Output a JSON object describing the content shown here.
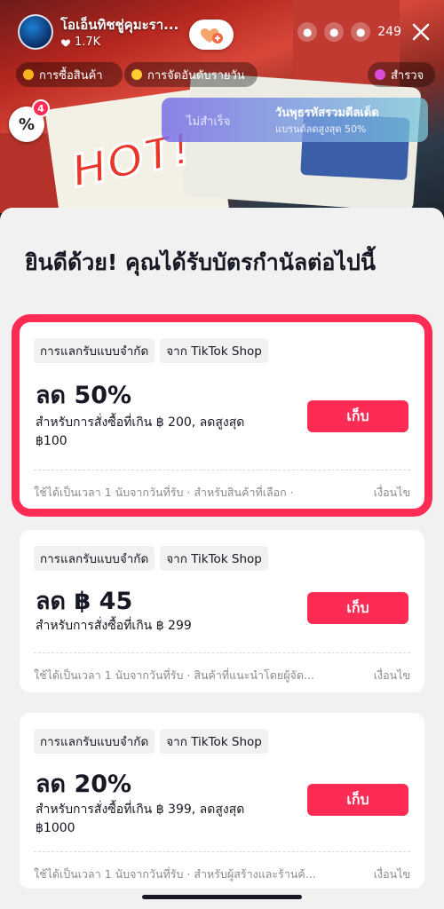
{
  "stream": {
    "host_name": "โอเอ็นทิชชู่คุมะรา...",
    "likes": "1.7K",
    "viewer_count": "249",
    "pills": [
      {
        "label": "การซื้อสินค้า"
      },
      {
        "label": "การจัดอันดับรายวัน"
      },
      {
        "label": "สำรวจ"
      }
    ],
    "coupon_badge": "4",
    "coupon_symbol": "%",
    "hot_sign": "HOT!",
    "promo": {
      "fail_text": "ไม่สำเร็จ",
      "title": "วันพุธรหัสรวมดีลเด็ด",
      "subtitle": "แบรนด์ลดสูงสุด 50%"
    }
  },
  "sheet": {
    "title": "ยินดีด้วย! คุณได้รับบัตรกำนัลต่อไปนี้",
    "vouchers": [
      {
        "tag_limited": "การแลกรับแบบจำกัด",
        "tag_source": "จาก TikTok Shop",
        "discount": "ลด 50%",
        "condition": "สำหรับการสั่งซื้อที่เกิน ฿ 200, ลดสูงสุด ฿100",
        "button": "เก็บ",
        "validity": "ใช้ได้เป็นเวลา 1 นับจากวันที่รับ · สำหรับสินค้าที่เลือก ·",
        "conditions_link": "เงื่อนไข"
      },
      {
        "tag_limited": "การแลกรับแบบจำกัด",
        "tag_source": "จาก TikTok Shop",
        "discount": "ลด ฿ 45",
        "condition": "สำหรับการสั่งซื้อที่เกิน ฿ 299",
        "button": "เก็บ",
        "validity": "ใช้ได้เป็นเวลา 1 นับจากวันที่รับ · สินค้าที่แนะนำโดยผู้จัด...",
        "conditions_link": "เงื่อนไข"
      },
      {
        "tag_limited": "การแลกรับแบบจำกัด",
        "tag_source": "จาก TikTok Shop",
        "discount": "ลด 20%",
        "condition": "สำหรับการสั่งซื้อที่เกิน ฿ 399, ลดสูงสุด ฿1000",
        "button": "เก็บ",
        "validity": "ใช้ได้เป็นเวลา 1 นับจากวันที่รับ · สำหรับผู้สร้างและร้านค้...",
        "conditions_link": "เงื่อนไข"
      }
    ]
  },
  "colors": {
    "accent": "#fe2c55",
    "text": "#161823",
    "muted": "#8a8b91",
    "sheet_bg": "#f1f1f2"
  },
  "icons": {
    "avatar": "avatar",
    "heart": "heart-icon",
    "follow": "follow-heart-plus-icon",
    "viewers": "viewer-avatar-icon",
    "close": "close-icon"
  }
}
